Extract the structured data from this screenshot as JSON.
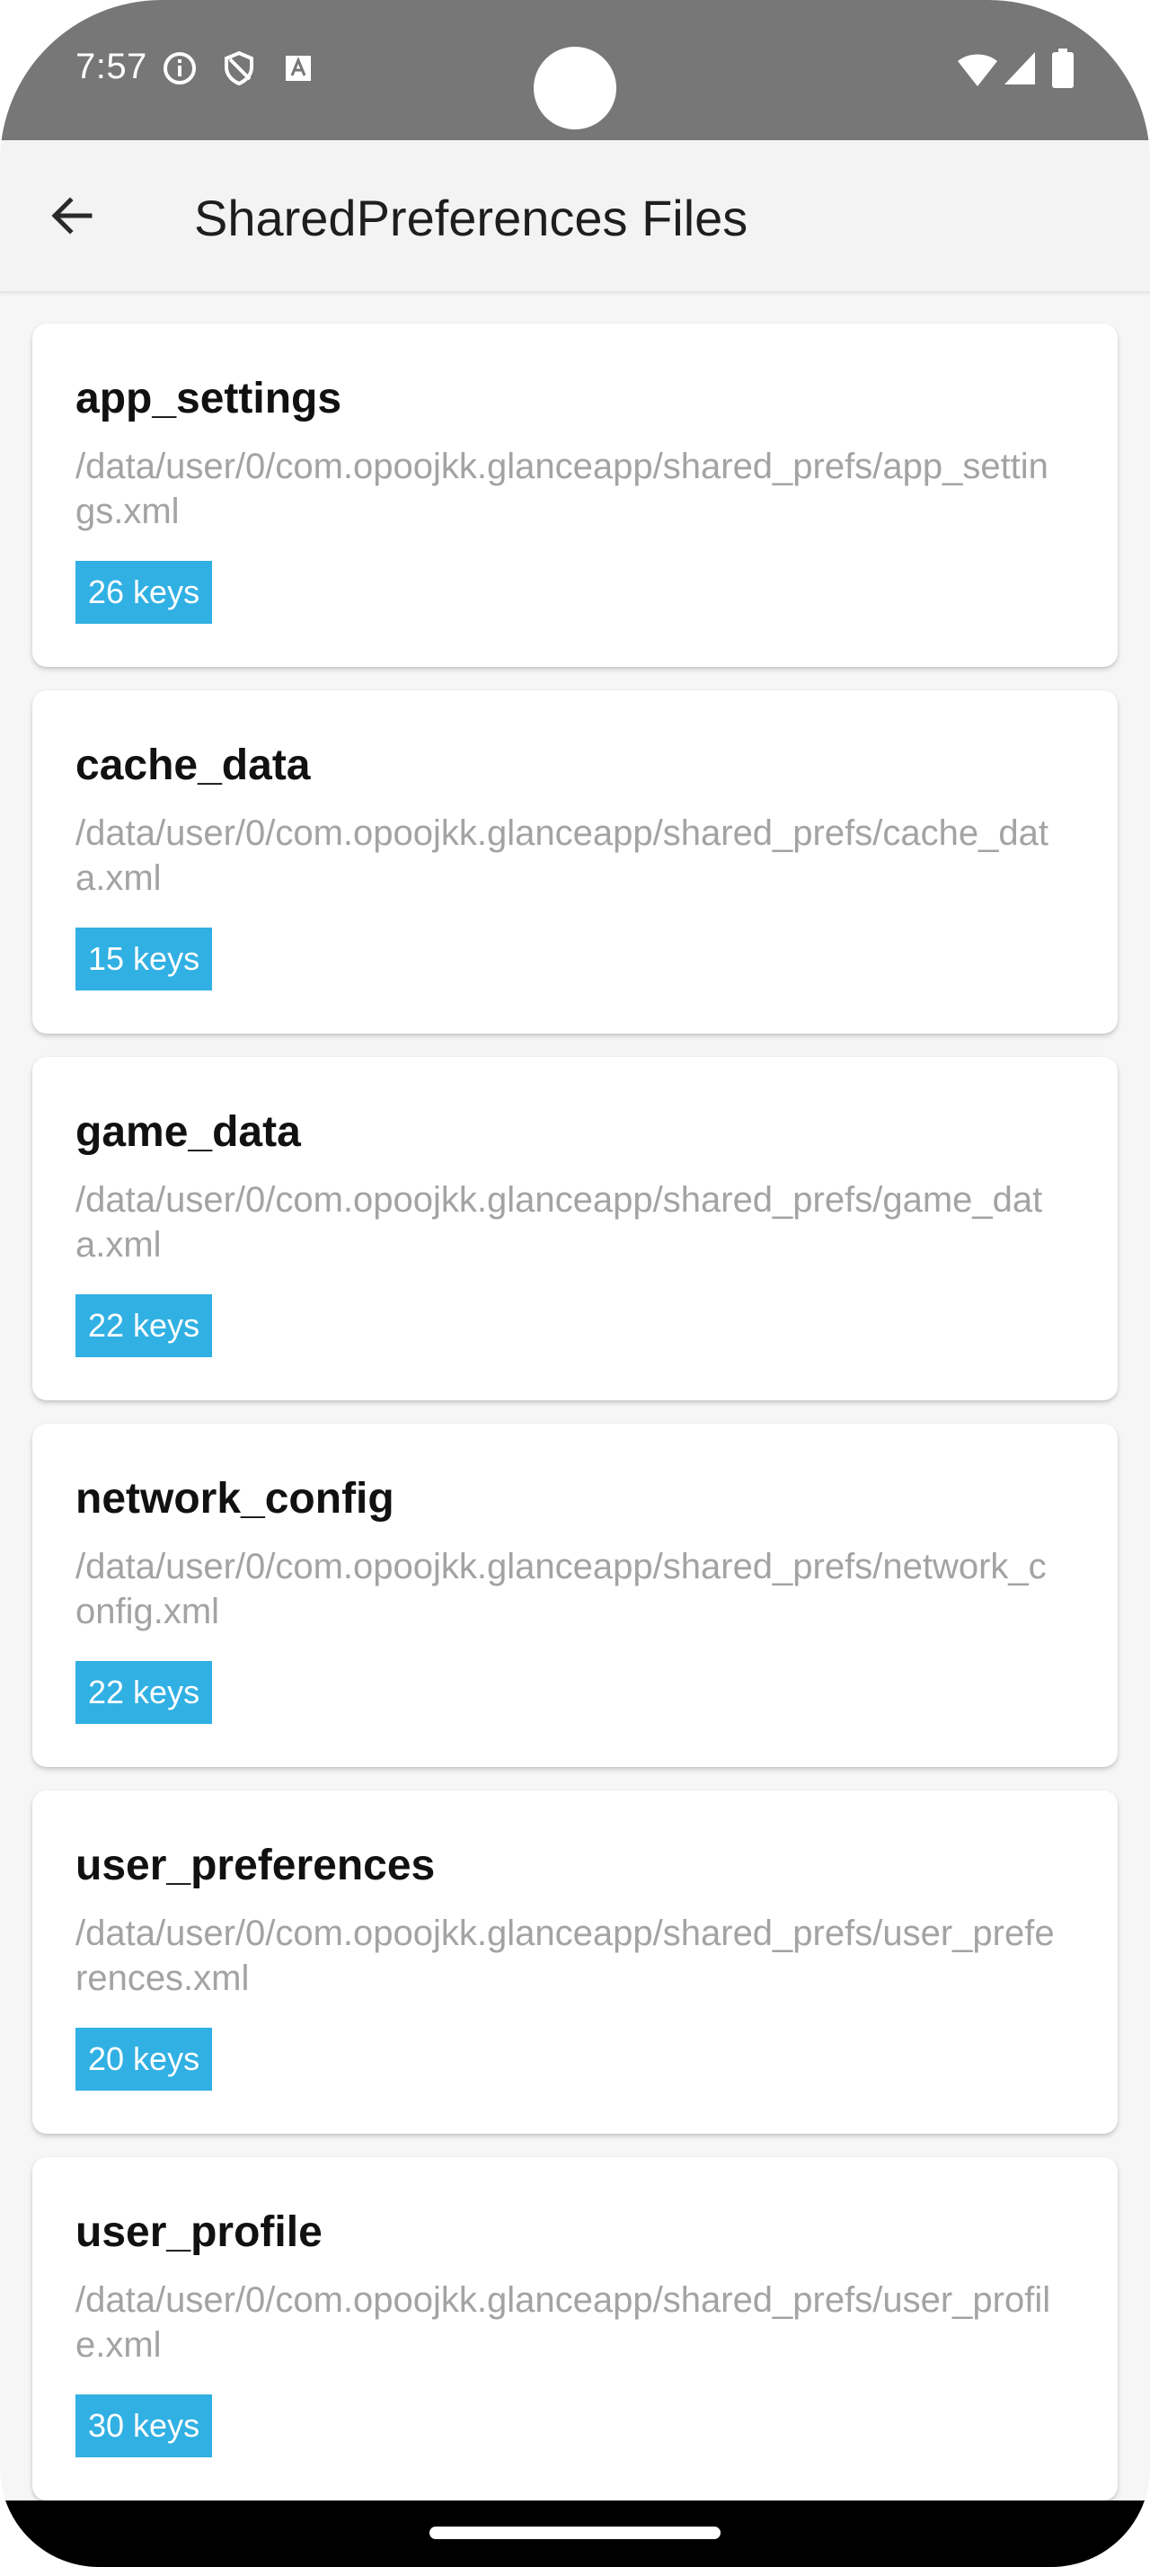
{
  "status_bar": {
    "time": "7:57",
    "left_icons": [
      "info-icon",
      "shield-icon",
      "font-icon"
    ],
    "right_icons": [
      "wifi-icon",
      "signal-icon",
      "battery-icon"
    ]
  },
  "app_bar": {
    "title": "SharedPreferences Files"
  },
  "files": [
    {
      "name": "app_settings",
      "path": "/data/user/0/com.opoojkk.glanceapp/shared_prefs/app_settings.xml",
      "badge": "26 keys"
    },
    {
      "name": "cache_data",
      "path": "/data/user/0/com.opoojkk.glanceapp/shared_prefs/cache_data.xml",
      "badge": "15 keys"
    },
    {
      "name": "game_data",
      "path": "/data/user/0/com.opoojkk.glanceapp/shared_prefs/game_data.xml",
      "badge": "22 keys"
    },
    {
      "name": "network_config",
      "path": "/data/user/0/com.opoojkk.glanceapp/shared_prefs/network_config.xml",
      "badge": "22 keys"
    },
    {
      "name": "user_preferences",
      "path": "/data/user/0/com.opoojkk.glanceapp/shared_prefs/user_preferences.xml",
      "badge": "20 keys"
    },
    {
      "name": "user_profile",
      "path": "/data/user/0/com.opoojkk.glanceapp/shared_prefs/user_profile.xml",
      "badge": "30 keys"
    }
  ],
  "colors": {
    "status_bar": "#777777",
    "badge": "#31b0e3",
    "path_text": "#a3a3a3",
    "background": "#f6f6f6"
  }
}
